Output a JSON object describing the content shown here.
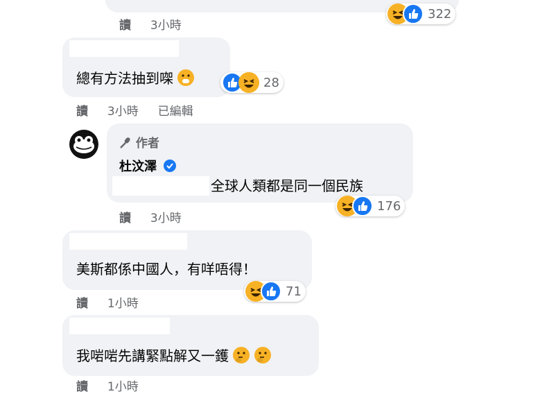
{
  "comments": [
    {
      "actions": {
        "read": "讀",
        "time": "3小時"
      },
      "reaction_count": "322"
    },
    {
      "text": "總有方法抽到㗎",
      "actions": {
        "read": "讀",
        "time": "3小時",
        "edited": "已編輯"
      },
      "reaction_count": "28"
    },
    {
      "author_label": "作者",
      "author_name": "杜汶澤",
      "text": "全球人類都是同一個民族",
      "actions": {
        "read": "讀",
        "time": "3小時"
      },
      "reaction_count": "176"
    },
    {
      "text": "美斯都係中國人，有咩唔得！",
      "actions": {
        "read": "讀",
        "time": "1小時"
      },
      "reaction_count": "71"
    },
    {
      "text": "我啱啱先講緊點解又一鑊",
      "actions": {
        "read": "讀",
        "time": "1小時"
      }
    }
  ],
  "colors": {
    "bubble": "#f0f2f5",
    "like": "#1877f2",
    "haha": "#f7b125",
    "muted": "#65676b"
  }
}
